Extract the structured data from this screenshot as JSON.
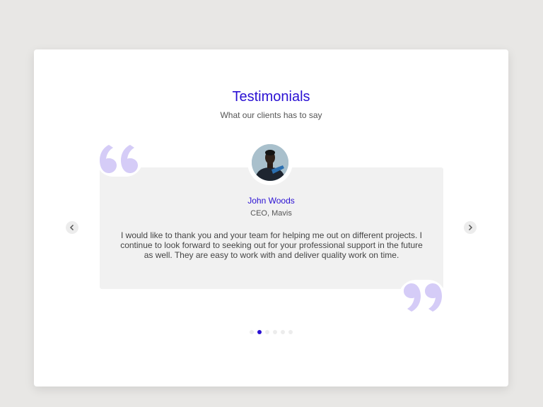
{
  "section": {
    "title": "Testimonials",
    "subtitle": "What our clients has to say"
  },
  "testimonial": {
    "name": "John Woods",
    "role": "CEO, Mavis",
    "message": "I would like to thank you and your team for helping me out on different projects. I continue to look forward to seeking out for your professional support in the future as well. They are easy to work with and deliver quality work on time."
  },
  "carousel": {
    "slide_count": 6,
    "active_index": 1
  },
  "colors": {
    "accent": "#2a10d3",
    "quote_mark": "#d5ccf7",
    "box_background": "#f1f1f1",
    "page_background": "#e8e7e5"
  },
  "icons": {
    "prev": "chevron-left-icon",
    "next": "chevron-right-icon",
    "open_quote": "open-quote-icon",
    "close_quote": "close-quote-icon"
  }
}
